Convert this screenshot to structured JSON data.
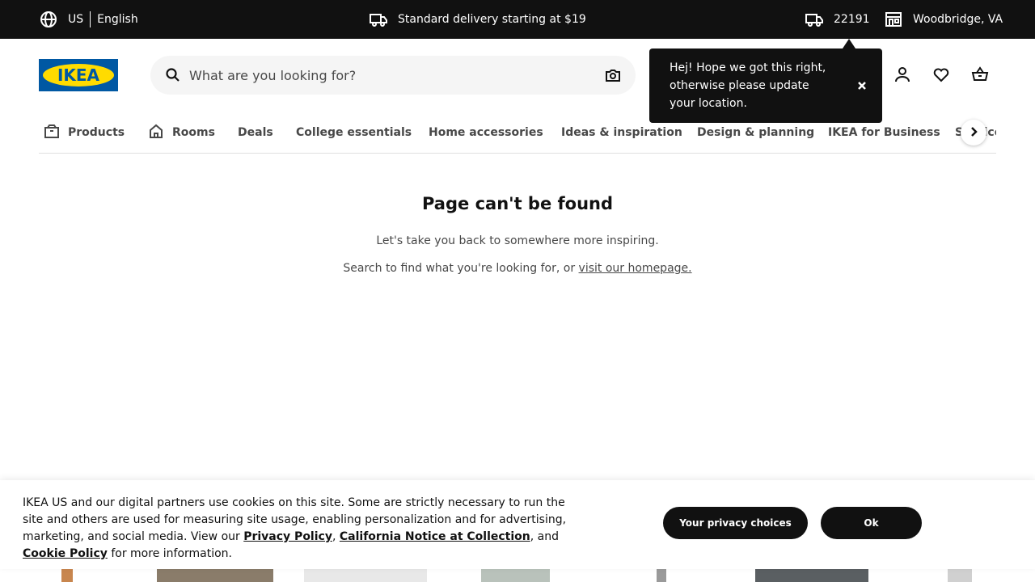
{
  "topbar": {
    "country": "US",
    "language": "English",
    "delivery_text": "Standard delivery starting at $19",
    "zip": "22191",
    "store": "Woodbridge, VA"
  },
  "header": {
    "logo_text": "IKEA",
    "search_placeholder": "What are you looking for?"
  },
  "tooltip": {
    "text": "Hej! Hope we got this right, otherwise please update your location."
  },
  "nav": {
    "items": [
      {
        "label": "Products"
      },
      {
        "label": "Rooms"
      },
      {
        "label": "Deals"
      },
      {
        "label": "College essentials"
      },
      {
        "label": "Home accessories"
      },
      {
        "label": "Ideas & inspiration"
      },
      {
        "label": "Design & planning"
      },
      {
        "label": "IKEA for Business"
      },
      {
        "label": "Service"
      }
    ]
  },
  "main": {
    "title": "Page can't be found",
    "line1": "Let's take you back to somewhere more inspiring.",
    "line2_prefix": "Search to find what you're looking for, or ",
    "line2_link": "visit our homepage."
  },
  "cookie": {
    "text_part1": "IKEA US and our digital partners use cookies on this site. Some are strictly necessary to run the site and others are used for measuring site usage, enabling personalization and for advertising, marketing, and social media. View our ",
    "privacy_link": "Privacy Policy",
    "sep1": ", ",
    "california_link": "California Notice at Collection",
    "sep2": ", and ",
    "cookie_link": "Cookie Policy",
    "text_part2": " for more information.",
    "privacy_choices_btn": "Your privacy choices",
    "ok_btn": "Ok"
  },
  "colors": {
    "topbar_bg": "#111111",
    "brand_blue": "#0058a3",
    "brand_yellow": "#ffdb00",
    "nav_text": "#484848"
  }
}
